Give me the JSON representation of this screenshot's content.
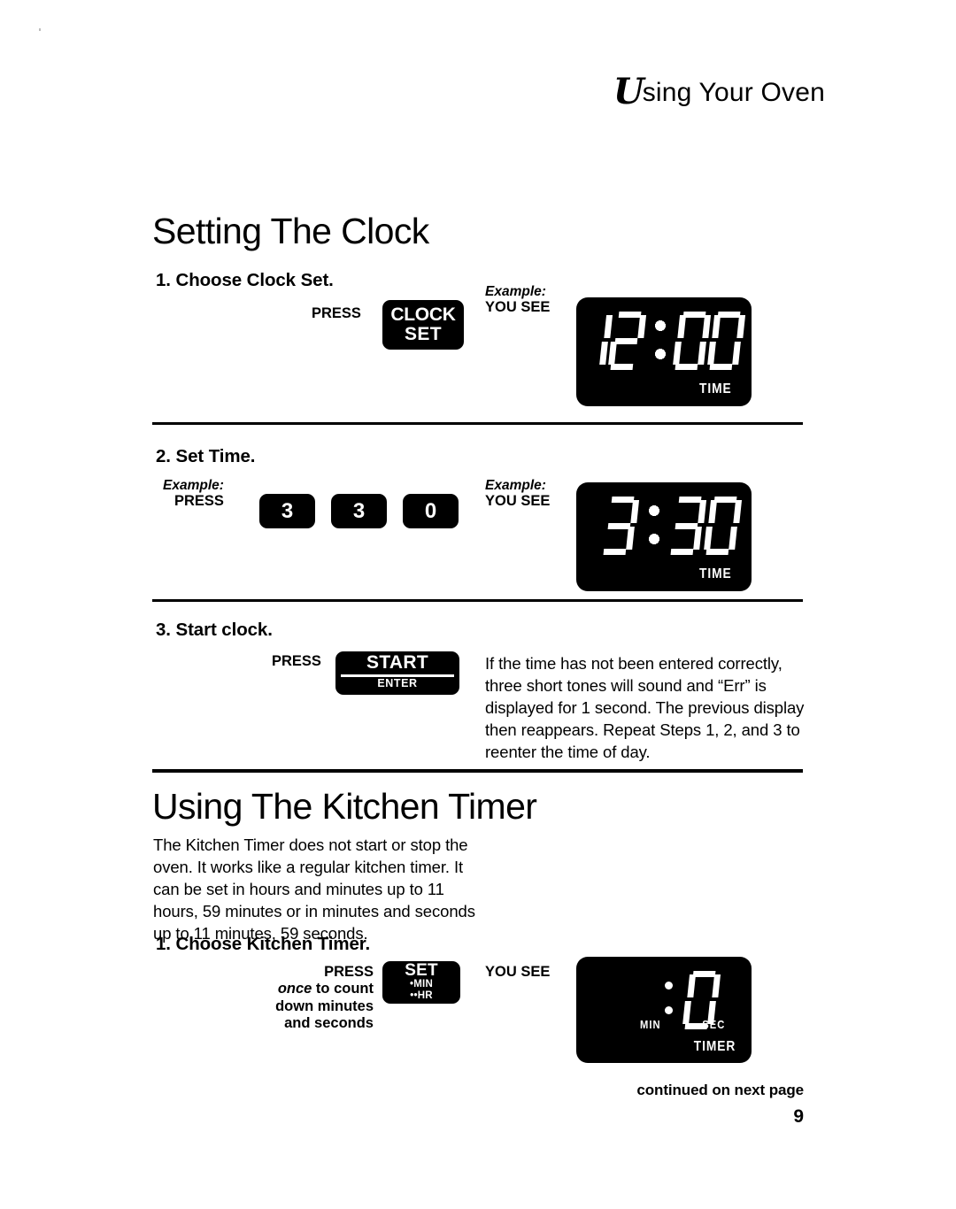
{
  "header": {
    "running_head_initial": "U",
    "running_head_rest": "sing Your Oven"
  },
  "sections": {
    "clock": {
      "title": "Setting The Clock",
      "steps": {
        "step1": {
          "heading": "1. Choose Clock Set.",
          "press_label": "PRESS",
          "you_see_example": "Example:",
          "you_see_label": "YOU SEE",
          "button": {
            "line1": "CLOCK",
            "line2": "SET"
          },
          "display": {
            "value": "12:00",
            "digits": "1200",
            "annunciator": "TIME"
          }
        },
        "step2": {
          "heading": "2. Set Time.",
          "press_example": "Example:",
          "press_label": "PRESS",
          "you_see_example": "Example:",
          "you_see_label": "YOU SEE",
          "keys": [
            "3",
            "3",
            "0"
          ],
          "display": {
            "value": "3:30",
            "digits": "330",
            "annunciator": "TIME"
          }
        },
        "step3": {
          "heading": "3. Start clock.",
          "press_label": "PRESS",
          "button": {
            "line1": "START",
            "line2": "ENTER"
          },
          "note": "If the time has not been entered correctly, three short tones will sound and “Err” is displayed for 1 second. The previous display then reappears. Repeat Steps 1, 2, and 3 to reenter the time of day."
        }
      }
    },
    "timer": {
      "title": "Using The Kitchen Timer",
      "intro": "The Kitchen Timer does not start or stop the oven. It works like a regular kitchen timer. It can be set in hours and minutes up to 11 hours, 59 minutes or in minutes and seconds up to 11 minutes, 59 seconds.",
      "steps": {
        "step1": {
          "heading": "1. Choose Kitchen Timer.",
          "press_label": "PRESS",
          "press_note_italic": "once",
          "press_note_rest": " to count down minutes and seconds",
          "you_see_label": "YOU SEE",
          "button": {
            "line1": "SET",
            "line2": "•MIN",
            "line3": "••HR"
          },
          "display": {
            "value": ": 0",
            "digits": "0",
            "annunciator_min": "MIN",
            "annunciator_sec": "SEC",
            "annunciator_timer": "TIMER"
          }
        }
      }
    }
  },
  "footer": {
    "continued": "continued on next page",
    "page_number": "9"
  },
  "colors": {
    "ink": "#000000",
    "paper": "#ffffff",
    "display_background": "#000000",
    "display_segment": "#ffffff"
  }
}
